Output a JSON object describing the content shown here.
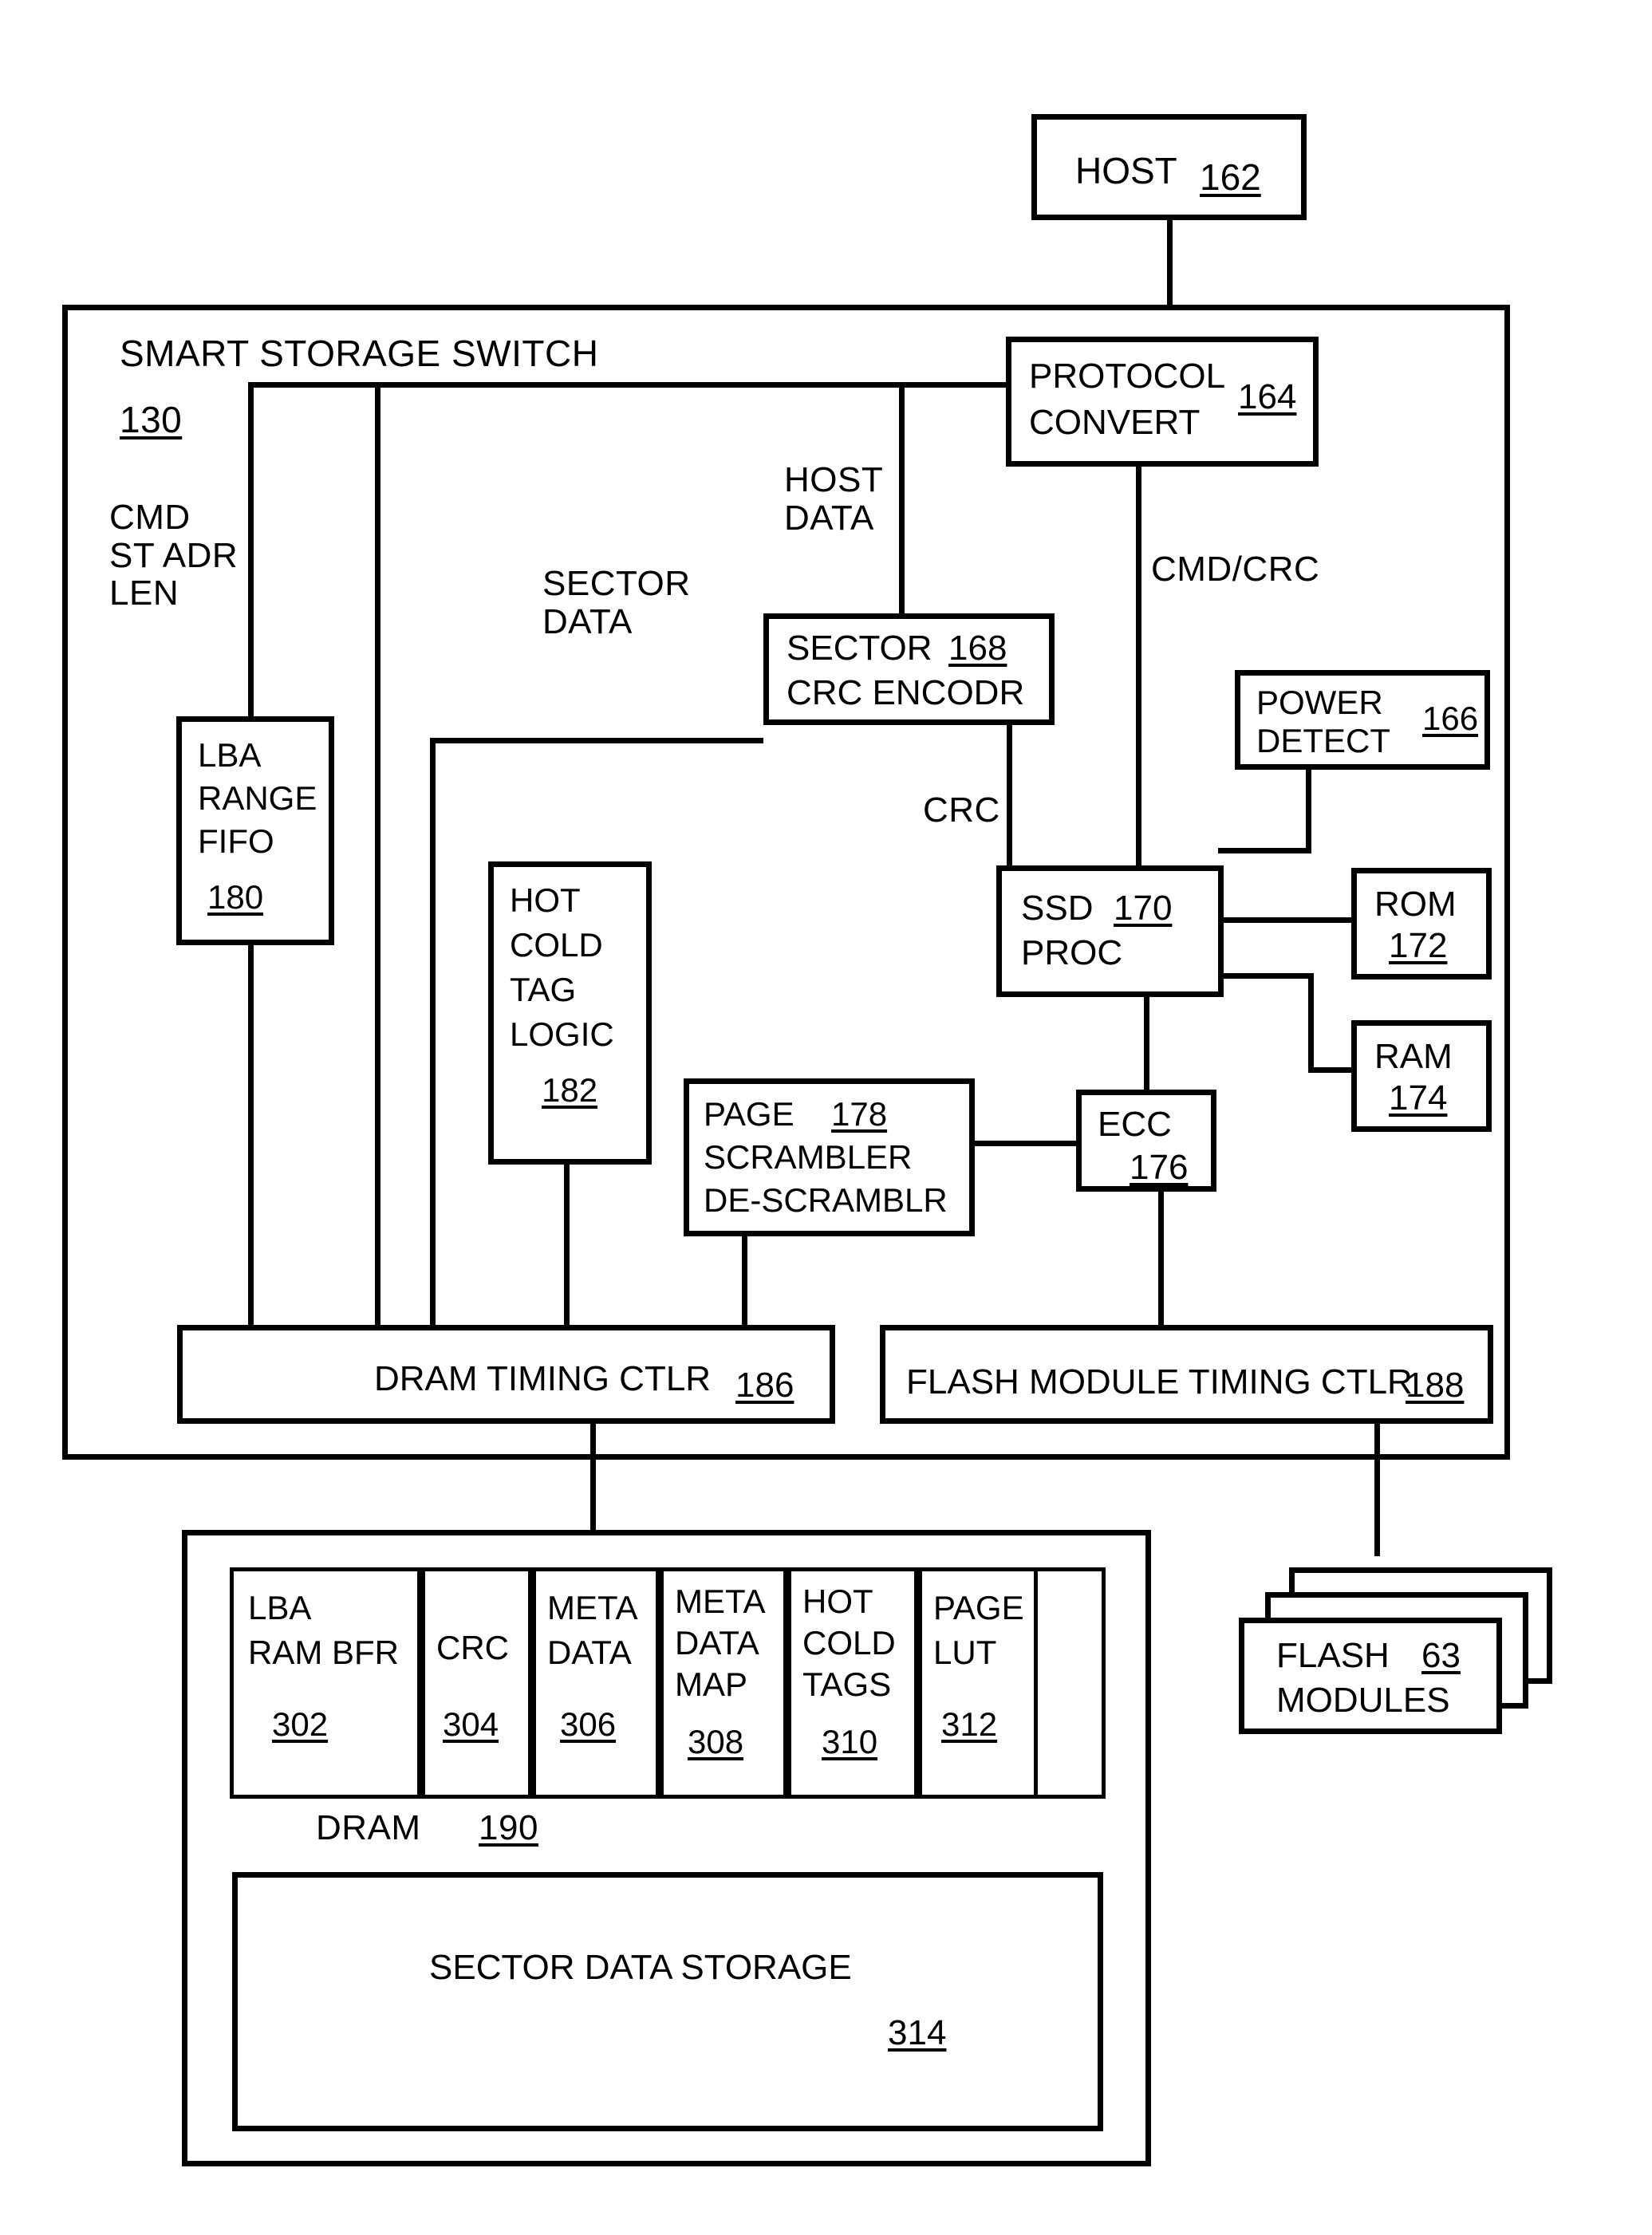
{
  "figure": {
    "title": "SMART STORAGE SWITCH",
    "title_ref": "130"
  },
  "blocks": {
    "host": {
      "label": "HOST",
      "ref": "162"
    },
    "protocol_convert": {
      "line1": "PROTOCOL",
      "line2": "CONVERT",
      "ref": "164"
    },
    "power_detect": {
      "line1": "POWER",
      "line2": "DETECT",
      "ref": "166"
    },
    "sector_crc_encoder": {
      "line1": "SECTOR",
      "line2": "CRC ENCODR",
      "ref": "168"
    },
    "ssd_proc": {
      "line1": "SSD",
      "line2": "PROC",
      "ref": "170"
    },
    "rom": {
      "label": "ROM",
      "ref": "172"
    },
    "ram": {
      "label": "RAM",
      "ref": "174"
    },
    "ecc": {
      "label": "ECC",
      "ref": "176"
    },
    "page_scrambler": {
      "line1": "PAGE",
      "line2": "SCRAMBLER",
      "line3": "DE-SCRAMBLR",
      "ref": "178"
    },
    "lba_range_fifo": {
      "line1": "LBA",
      "line2": "RANGE",
      "line3": "FIFO",
      "ref": "180"
    },
    "hot_cold_tag_logic": {
      "line1": "HOT",
      "line2": "COLD",
      "line3": "TAG",
      "line4": "LOGIC",
      "ref": "182"
    },
    "dram_timing_ctlr": {
      "label": "DRAM TIMING CTLR",
      "ref": "186"
    },
    "flash_module_timing_ctlr": {
      "label": "FLASH MODULE TIMING CTLR",
      "ref": "188"
    },
    "flash_modules": {
      "line1": "FLASH",
      "line2": "MODULES",
      "ref": "63"
    },
    "dram": {
      "label": "DRAM",
      "ref": "190"
    },
    "sector_data_storage": {
      "label": "SECTOR DATA STORAGE",
      "ref": "314"
    }
  },
  "dram_cells": [
    {
      "name": "lba-ram-bfr",
      "line1": "LBA",
      "line2": "RAM BFR",
      "ref": "302"
    },
    {
      "name": "crc",
      "line1": "CRC",
      "line2": "",
      "ref": "304"
    },
    {
      "name": "meta-data",
      "line1": "META",
      "line2": "DATA",
      "ref": "306"
    },
    {
      "name": "meta-data-map",
      "line1": "META",
      "line2": "DATA",
      "line3": "MAP",
      "ref": "308"
    },
    {
      "name": "hot-cold-tags",
      "line1": "HOT",
      "line2": "COLD",
      "line3": "TAGS",
      "ref": "310"
    },
    {
      "name": "page-lut",
      "line1": "PAGE",
      "line2": "LUT",
      "ref": "312"
    }
  ],
  "wire_labels": {
    "cmd_st_adr_len": "CMD\nST ADR\nLEN",
    "sector_data": "SECTOR\nDATA",
    "host_data": "HOST\nDATA",
    "cmd_crc": "CMD/CRC",
    "crc": "CRC"
  },
  "colors": {
    "line": "#000000",
    "background": "#ffffff"
  }
}
